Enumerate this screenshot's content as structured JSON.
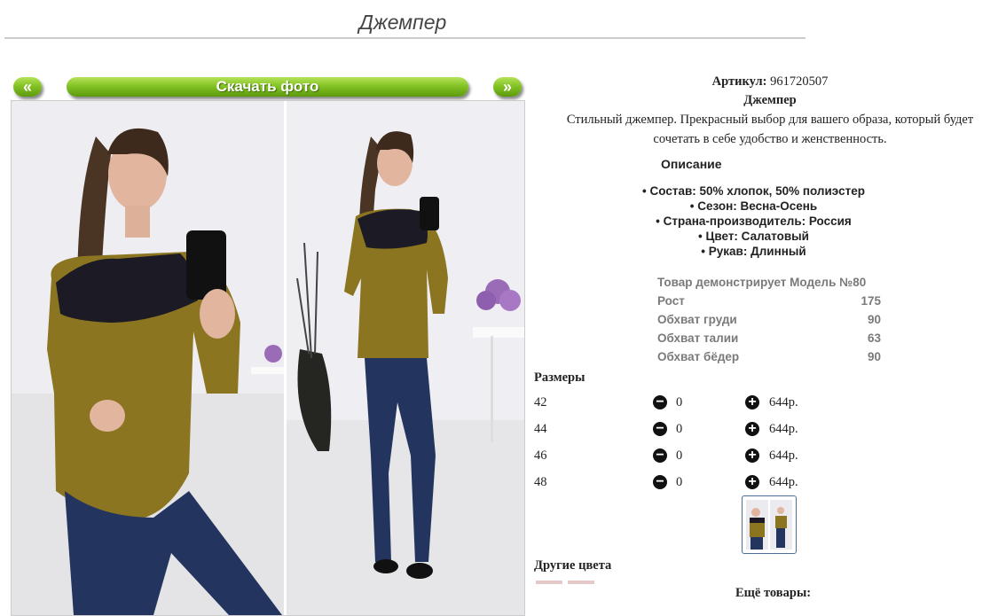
{
  "page": {
    "title": "Джемпер"
  },
  "gallery": {
    "prev_label": "«",
    "next_label": "»",
    "download_label": "Скачать фото"
  },
  "product": {
    "article_label": "Артикул:",
    "article_value": "961720507",
    "name": "Джемпер",
    "description": "Стильный джемпер. Прекрасный выбор для вашего образа, который будет сочетать в себе удобство и женственность."
  },
  "details": {
    "heading": "Описание",
    "properties": [
      "Состав: 50% хлопок, 50% полиэстер",
      "Сезон: Весна-Осень",
      "Страна-производитель: Россия",
      "Цвет: Салатовый",
      "Рукав: Длинный"
    ]
  },
  "model": {
    "heading": "Товар демонстрирует Модель №80",
    "measurements": [
      {
        "label": "Рост",
        "value": "175"
      },
      {
        "label": "Обхват груди",
        "value": "90"
      },
      {
        "label": "Обхват талии",
        "value": "63"
      },
      {
        "label": "Обхват бёдер",
        "value": "90"
      }
    ]
  },
  "sizes": {
    "heading": "Размеры",
    "rows": [
      {
        "size": "42",
        "qty": "0",
        "price": "644р."
      },
      {
        "size": "44",
        "qty": "0",
        "price": "644р."
      },
      {
        "size": "46",
        "qty": "0",
        "price": "644р."
      },
      {
        "size": "48",
        "qty": "0",
        "price": "644р."
      }
    ],
    "minus_symbol": "−",
    "plus_symbol": "+"
  },
  "other_colors": {
    "heading": "Другие цвета"
  },
  "more_products": {
    "heading": "Ещё товары:"
  },
  "colors": {
    "accent_green": "#84c325",
    "thumb_border": "#4c6f95"
  }
}
